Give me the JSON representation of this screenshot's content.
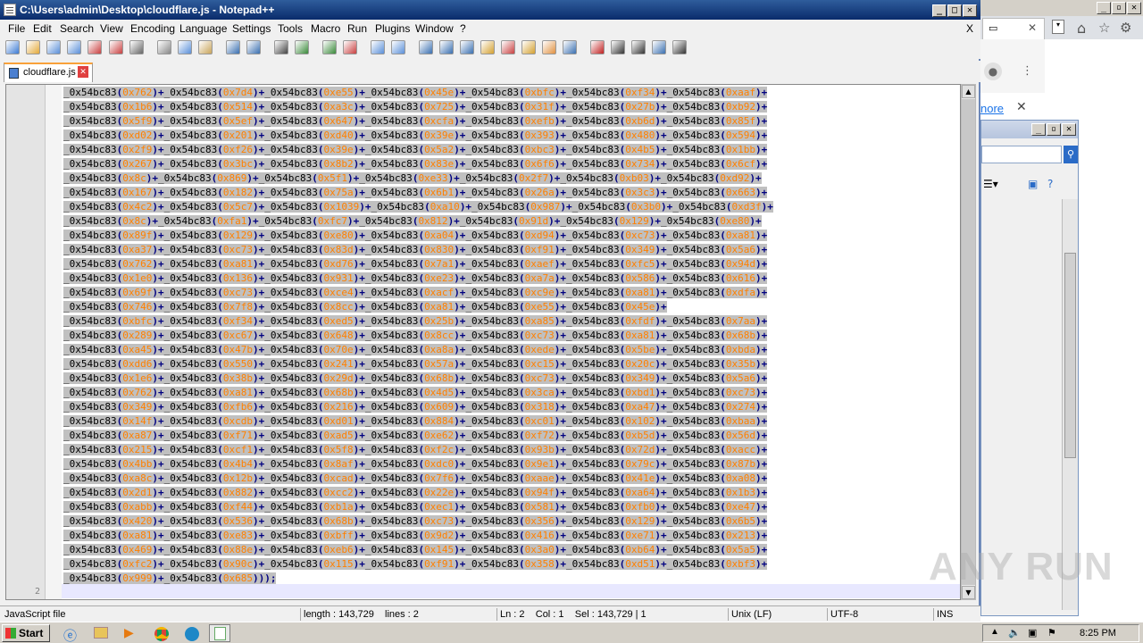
{
  "window": {
    "title": "C:\\Users\\admin\\Desktop\\cloudflare.js - Notepad++",
    "minimize": "_",
    "maximize": "□",
    "close": "✕",
    "doc_close": "X"
  },
  "menu": [
    "File",
    "Edit",
    "Search",
    "View",
    "Encoding",
    "Language",
    "Settings",
    "Tools",
    "Macro",
    "Run",
    "Plugins",
    "Window",
    "?"
  ],
  "toolbar_icons": [
    "new-file-icon",
    "open-file-icon",
    "save-icon",
    "save-all-icon",
    "close-icon",
    "close-all-icon",
    "print-icon",
    "cut-icon",
    "copy-icon",
    "paste-icon",
    "undo-icon",
    "redo-icon",
    "find-icon",
    "replace-icon",
    "zoom-in-icon",
    "zoom-out-icon",
    "sync-v-icon",
    "sync-h-icon",
    "word-wrap-icon",
    "all-chars-icon",
    "indent-guide-icon",
    "user-lang-icon",
    "doc-map-icon",
    "function-list-icon",
    "folder-workspace-icon",
    "monitor-icon",
    "record-macro-icon",
    "stop-macro-icon",
    "play-macro-icon",
    "run-macro-multi-icon",
    "save-macro-icon"
  ],
  "tab": {
    "label": "cloudflare.js",
    "close": "✕"
  },
  "editor": {
    "fn": "_0x54bc83",
    "line_numbers": {
      "current": "2"
    },
    "lines": [
      [
        "0x762",
        "0x7d4",
        "0xe55",
        "0x45e",
        "0xbfc",
        "0xf34",
        "0xaaf"
      ],
      [
        "0x1b6",
        "0x514",
        "0xa3c",
        "0x725",
        "0x31f",
        "0x27b",
        "0xb92"
      ],
      [
        "0x5f9",
        "0x5ef",
        "0x647",
        "0xcfa",
        "0xefb",
        "0xb6d",
        "0x85f"
      ],
      [
        "0xd02",
        "0x201",
        "0xd40",
        "0x39e",
        "0x393",
        "0x480",
        "0x594"
      ],
      [
        "0x2f9",
        "0xf26",
        "0x39e",
        "0x5a2",
        "0xbc3",
        "0x4b5",
        "0x1bb"
      ],
      [
        "0x267",
        "0x3bc",
        "0x8b2",
        "0x83e",
        "0x6f6",
        "0x734",
        "0x6cf"
      ],
      [
        "0x8c",
        "0x869",
        "0x5f1",
        "0xe33",
        "0x2f7",
        "0xb03",
        "0xd92"
      ],
      [
        "0x167",
        "0x182",
        "0x75a",
        "0x6b1",
        "0x26a",
        "0x3c3",
        "0x663"
      ],
      [
        "0x4c2",
        "0x5c7",
        "0x1039",
        "0xa10",
        "0x987",
        "0x3b0",
        "0xd3f"
      ],
      [
        "0x8c",
        "0xfa1",
        "0xfc7",
        "0x812",
        "0x91d",
        "0x129",
        "0xe80"
      ],
      [
        "0x89f",
        "0x129",
        "0xe80",
        "0xa04",
        "0xd94",
        "0xc73",
        "0xa81"
      ],
      [
        "0xa37",
        "0xc73",
        "0x83d",
        "0x830",
        "0xf91",
        "0x349",
        "0x5a6"
      ],
      [
        "0x762",
        "0xa81",
        "0xd76",
        "0x7a1",
        "0xaef",
        "0xfc5",
        "0x94d"
      ],
      [
        "0x1e0",
        "0x136",
        "0x931",
        "0xe23",
        "0xa7a",
        "0x586",
        "0x616"
      ],
      [
        "0x69f",
        "0xc73",
        "0xce4",
        "0xacf",
        "0xc9e",
        "0xa81",
        "0xdfa"
      ],
      [
        "0x746",
        "0x7f8",
        "0x8cc",
        "0xa81",
        "0xe55",
        "0x45e"
      ],
      [
        "0xbfc",
        "0xf34",
        "0xed5",
        "0x25b",
        "0xa85",
        "0xfdf",
        "0x7aa"
      ],
      [
        "0x289",
        "0xc67",
        "0x648",
        "0x8cc",
        "0xc73",
        "0xa81",
        "0x68b"
      ],
      [
        "0xa45",
        "0x47b",
        "0x70e",
        "0xa8a",
        "0xede",
        "0x5be",
        "0xbda"
      ],
      [
        "0xdd6",
        "0x550",
        "0x241",
        "0x57a",
        "0xc15",
        "0x20c",
        "0x35b"
      ],
      [
        "0x1e6",
        "0x38b",
        "0x29d",
        "0x68b",
        "0xc73",
        "0x349",
        "0x5a6"
      ],
      [
        "0x762",
        "0xa81",
        "0x68b",
        "0x4d5",
        "0x3ca",
        "0xbd1",
        "0xc73"
      ],
      [
        "0x349",
        "0xfb6",
        "0x216",
        "0x609",
        "0x318",
        "0xa47",
        "0x274"
      ],
      [
        "0x14f",
        "0xcdb",
        "0xd01",
        "0x884",
        "0xc01",
        "0x102",
        "0xbaa"
      ],
      [
        "0xa87",
        "0xf71",
        "0xad5",
        "0xe62",
        "0xf72",
        "0xb5d",
        "0x56d"
      ],
      [
        "0x215",
        "0xcf1",
        "0x5f8",
        "0xf2c",
        "0x93b",
        "0x72d",
        "0xacc"
      ],
      [
        "0x4bb",
        "0x4b4",
        "0x8af",
        "0xdc0",
        "0x9e1",
        "0x79c",
        "0x87b"
      ],
      [
        "0xa8c",
        "0x12b",
        "0xcad",
        "0x7f6",
        "0xaae",
        "0x41e",
        "0xa08"
      ],
      [
        "0x2d1",
        "0x882",
        "0xcc2",
        "0x22e",
        "0x94f",
        "0xa64",
        "0x1b3"
      ],
      [
        "0xabb",
        "0xf44",
        "0xb1a",
        "0xec1",
        "0x581",
        "0xfb0",
        "0xe47"
      ],
      [
        "0x420",
        "0x536",
        "0x68b",
        "0xc73",
        "0x356",
        "0x129",
        "0x6b5"
      ],
      [
        "0xa81",
        "0xe83",
        "0xbff",
        "0x9d2",
        "0x416",
        "0xe71",
        "0x213"
      ],
      [
        "0x469",
        "0x88e",
        "0xeb6",
        "0x145",
        "0x3a0",
        "0xb64",
        "0x5a5"
      ],
      [
        "0xfc2",
        "0x90c",
        "0x115",
        "0xf91",
        "0x358",
        "0xd51",
        "0xbf3"
      ]
    ],
    "last_line": [
      "0x999",
      "0x685"
    ],
    "last_line_tail": "));"
  },
  "status": {
    "type": "JavaScript file",
    "length": "length : 143,729",
    "lines": "lines : 2",
    "pos": "Ln : 2    Col : 1    Sel : 143,729 | 1",
    "eol": "Unix (LF)",
    "encoding": "UTF-8",
    "mode": "INS"
  },
  "taskbar": {
    "start": "Start",
    "time": "8:25 PM"
  },
  "background": {
    "more_link": "nore",
    "close_x": "✕"
  },
  "watermark": "ANY RUN",
  "colors": {
    "hex": "#ff8000",
    "title_bar": "#0a2b6b",
    "selection": "#c0c0c0"
  }
}
